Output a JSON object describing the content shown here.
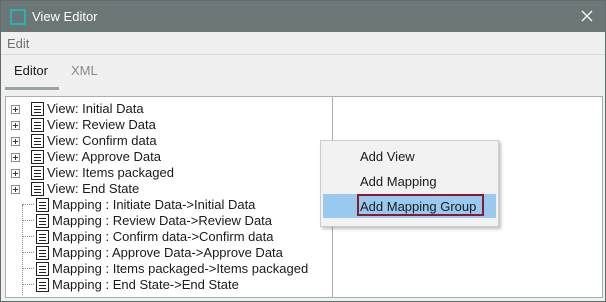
{
  "window": {
    "title": "View Editor"
  },
  "menu": {
    "edit": "Edit"
  },
  "tabs": [
    {
      "label": "Editor",
      "active": true
    },
    {
      "label": "XML",
      "active": false
    }
  ],
  "tree": {
    "views": [
      "View: Initial Data",
      "View: Review Data",
      "View: Confirm data",
      "View: Approve Data",
      "View: Items packaged",
      "View: End State"
    ],
    "mappings": [
      "Mapping : Initiate Data->Initial Data",
      "Mapping : Review Data->Review Data",
      "Mapping : Confirm data->Confirm data",
      "Mapping : Approve Data->Approve Data",
      "Mapping : Items packaged->Items packaged",
      "Mapping : End State->End State"
    ]
  },
  "context_menu": {
    "items": [
      "Add View",
      "Add Mapping",
      "Add Mapping Group"
    ],
    "highlighted": "Add Mapping Group"
  },
  "colors": {
    "titlebar": "#6b7677",
    "title_icon": "#29b0b0",
    "menu_highlight": "#99c9ef",
    "focus_border": "#8b1a2e"
  }
}
